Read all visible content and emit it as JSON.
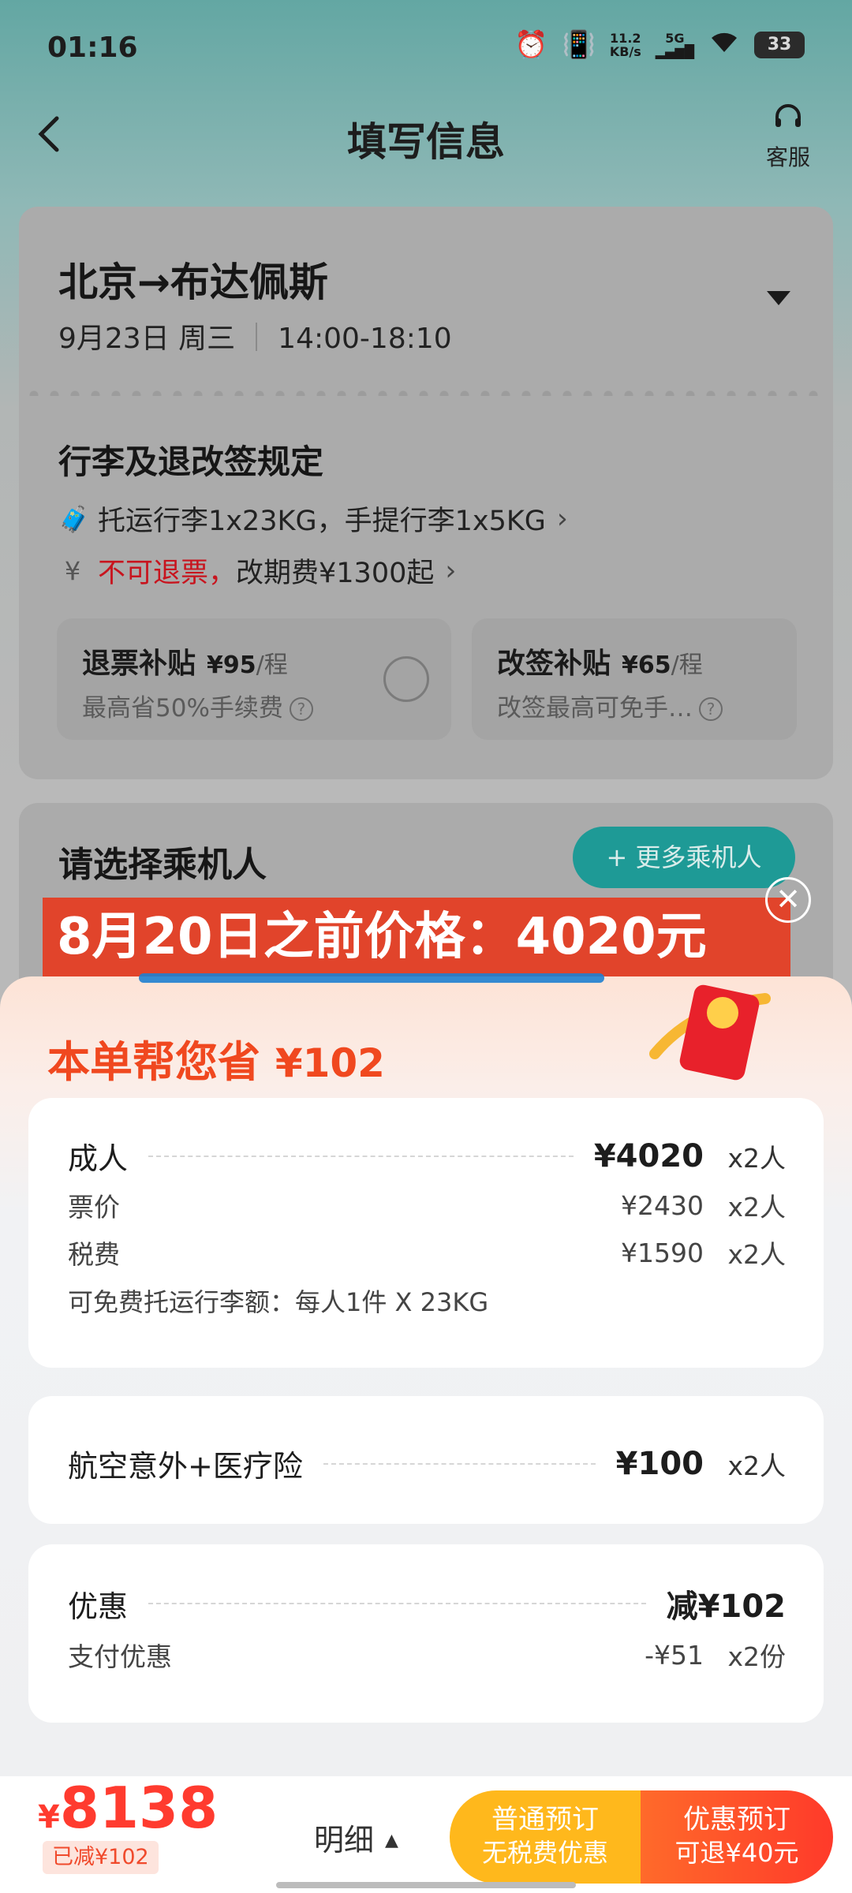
{
  "status_bar": {
    "time": "01:16",
    "net_speed": "11.2",
    "net_unit": "KB/s",
    "net_type": "5G",
    "battery": "33"
  },
  "header": {
    "back_icon": "chevron-left-icon",
    "title": "填写信息",
    "service_label": "客服"
  },
  "flight": {
    "route": "北京→布达佩斯",
    "date": "9月23日 周三",
    "time": "14:00-18:10"
  },
  "rules": {
    "title": "行李及退改签规定",
    "baggage": "托运行李1x23KG，手提行李1x5KG",
    "refund_red": "不可退票，",
    "change_fee": "改期费¥1300起"
  },
  "subsidies": [
    {
      "title": "退票补贴",
      "price": "¥95",
      "unit": "/程",
      "desc": "最高省50%手续费"
    },
    {
      "title": "改签补贴",
      "price": "¥65",
      "unit": "/程",
      "desc": "改签最高可免手…"
    }
  ],
  "passengers": {
    "title": "请选择乘机人",
    "more_button": "+ 更多乘机人"
  },
  "banner": {
    "text": "8月20日之前价格：4020元"
  },
  "sheet": {
    "save_title": "本单帮您省",
    "save_amount": "¥102",
    "fare": {
      "label": "成人",
      "price": "¥4020",
      "count": "x2人",
      "ticket_label": "票价",
      "ticket_price": "¥2430",
      "ticket_count": "x2人",
      "tax_label": "税费",
      "tax_price": "¥1590",
      "tax_count": "x2人",
      "baggage_note": "可免费托运行李额：每人1件 X 23KG"
    },
    "insurance": {
      "label": "航空意外+医疗险",
      "price": "¥100",
      "count": "x2人"
    },
    "discount": {
      "label": "优惠",
      "value": "减¥102",
      "pay_label": "支付优惠",
      "pay_value": "-¥51",
      "pay_count": "x2份"
    }
  },
  "bottom_bar": {
    "currency": "¥",
    "total": "8138",
    "reduced": "已减¥102",
    "detail_label": "明细",
    "normal_btn": {
      "title": "普通预订",
      "sub": "无税费优惠"
    },
    "discount_btn": {
      "title": "优惠预订",
      "sub": "可退¥40元"
    }
  },
  "colors": {
    "accent_orange": "#ff3b2f",
    "teal": "#1e9a96",
    "banner_red": "#e1442b",
    "normal_btn": "#ffb81c"
  }
}
